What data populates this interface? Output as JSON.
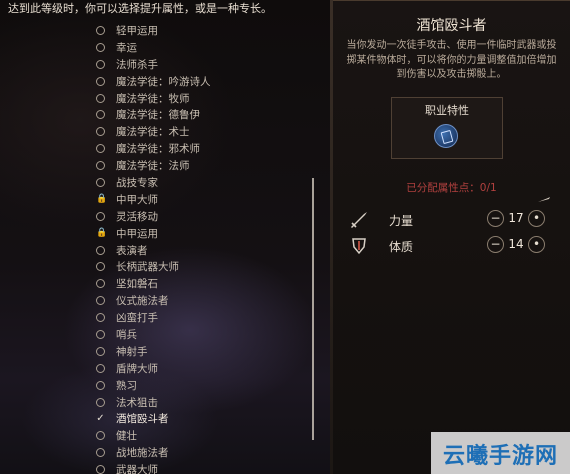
{
  "hint": "达到此等级时，你可以选择提升属性，或是一种专长。",
  "feats": [
    {
      "label": "轻甲运用",
      "state": "radio"
    },
    {
      "label": "幸运",
      "state": "radio"
    },
    {
      "label": "法师杀手",
      "state": "radio"
    },
    {
      "label": "魔法学徒：吟游诗人",
      "state": "radio"
    },
    {
      "label": "魔法学徒：牧师",
      "state": "radio"
    },
    {
      "label": "魔法学徒：德鲁伊",
      "state": "radio"
    },
    {
      "label": "魔法学徒：术士",
      "state": "radio"
    },
    {
      "label": "魔法学徒：邪术师",
      "state": "radio"
    },
    {
      "label": "魔法学徒：法师",
      "state": "radio"
    },
    {
      "label": "战技专家",
      "state": "radio"
    },
    {
      "label": "中甲大师",
      "state": "locked"
    },
    {
      "label": "灵活移动",
      "state": "radio"
    },
    {
      "label": "中甲运用",
      "state": "locked"
    },
    {
      "label": "表演者",
      "state": "radio"
    },
    {
      "label": "长柄武器大师",
      "state": "radio"
    },
    {
      "label": "坚如磐石",
      "state": "radio"
    },
    {
      "label": "仪式施法者",
      "state": "radio"
    },
    {
      "label": "凶蛮打手",
      "state": "radio"
    },
    {
      "label": "哨兵",
      "state": "radio"
    },
    {
      "label": "神射手",
      "state": "radio"
    },
    {
      "label": "盾牌大师",
      "state": "radio"
    },
    {
      "label": "熟习",
      "state": "radio"
    },
    {
      "label": "法术狙击",
      "state": "radio"
    },
    {
      "label": "酒馆殴斗者",
      "state": "checked"
    },
    {
      "label": "健壮",
      "state": "radio"
    },
    {
      "label": "战地施法者",
      "state": "radio"
    },
    {
      "label": "武器大师",
      "state": "radio"
    }
  ],
  "detail": {
    "title": "酒馆殴斗者",
    "desc_lines": [
      "当你发动一次徒手攻击、使用一件临时武器或投",
      "掷某件物体时，可以将你的力量调整值加倍增加",
      "到伤害以及攻击掷骰上。"
    ],
    "trait_label": "职业特性",
    "trait_icon": "class-feature-icon",
    "points_text": "已分配属性点：0/1",
    "stats": [
      {
        "name": "力量",
        "value": "17",
        "icon": "strength-sword-icon"
      },
      {
        "name": "体质",
        "value": "14",
        "icon": "constitution-shield-icon"
      }
    ]
  },
  "watermark": "云曦手游网",
  "colors": {
    "points": "#b0403e",
    "accent": "#efe4d4"
  }
}
